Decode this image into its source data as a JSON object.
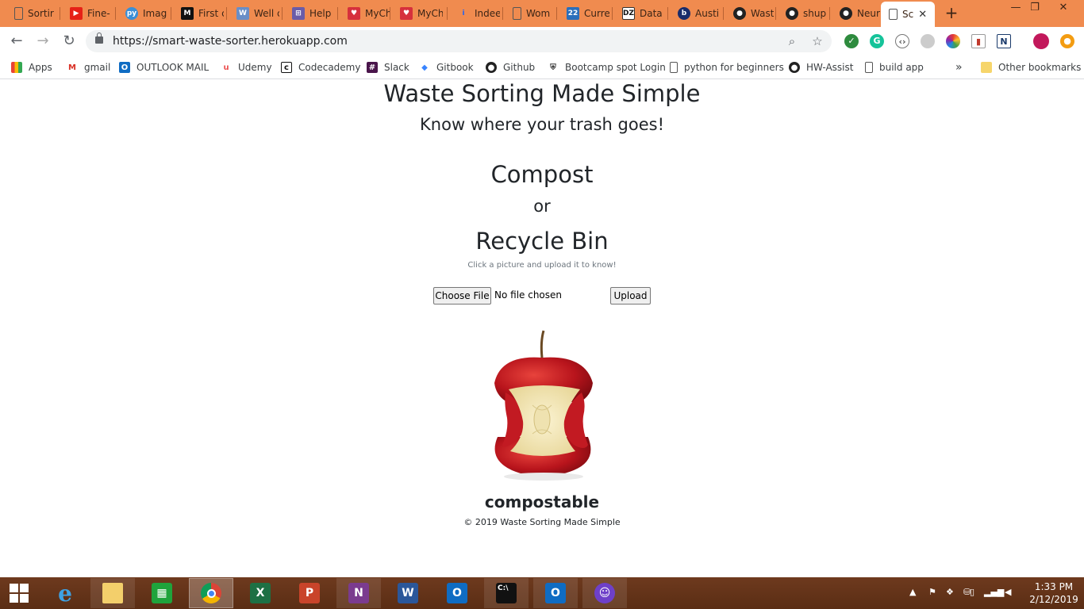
{
  "browser": {
    "tabs": [
      {
        "label": "Sortir",
        "icon": "document-icon"
      },
      {
        "label": "Fine-",
        "icon": "youtube-icon"
      },
      {
        "label": "Imag",
        "icon": "pypi-icon"
      },
      {
        "label": "First c",
        "icon": "medium-icon"
      },
      {
        "label": "Well c",
        "icon": "webmd-icon"
      },
      {
        "label": "Help",
        "icon": "grid-icon"
      },
      {
        "label": "MyCh",
        "icon": "mychart-icon"
      },
      {
        "label": "MyCh",
        "icon": "mychart-icon"
      },
      {
        "label": "Indee",
        "icon": "indeed-icon"
      },
      {
        "label": "Wom",
        "icon": "document-icon"
      },
      {
        "label": "Curre",
        "icon": "calendar-22-icon"
      },
      {
        "label": "Data",
        "icon": "dzone-icon"
      },
      {
        "label": "Austi",
        "icon": "b-icon"
      },
      {
        "label": "Wast",
        "icon": "github-icon"
      },
      {
        "label": "shup",
        "icon": "github-icon"
      },
      {
        "label": "Neur",
        "icon": "github-icon"
      }
    ],
    "active_tab": {
      "label": "Sc",
      "icon": "document-icon"
    },
    "url": "https://smart-waste-sorter.herokuapp.com",
    "bookmarks": [
      {
        "label": "Apps",
        "icon": "apps-grid-icon"
      },
      {
        "label": "gmail",
        "icon": "gmail-icon"
      },
      {
        "label": "OUTLOOK MAIL",
        "icon": "outlook-icon"
      },
      {
        "label": "Udemy",
        "icon": "udemy-icon"
      },
      {
        "label": "Codecademy",
        "icon": "codecademy-icon"
      },
      {
        "label": "Slack",
        "icon": "slack-icon"
      },
      {
        "label": "Gitbook",
        "icon": "gitbook-icon"
      },
      {
        "label": "Github",
        "icon": "github-icon"
      },
      {
        "label": "Bootcamp spot Login",
        "icon": "shield-icon"
      },
      {
        "label": "python for beginners",
        "icon": "document-icon"
      },
      {
        "label": "HW-Assist",
        "icon": "github-icon"
      },
      {
        "label": "build app",
        "icon": "document-icon"
      }
    ],
    "bookmarks_overflow": "»",
    "other_bookmarks": "Other bookmarks"
  },
  "page": {
    "title": "Waste Sorting Made Simple",
    "subtitle": "Know where your trash goes!",
    "option_a": "Compost",
    "connector": "or",
    "option_b": "Recycle Bin",
    "hint": "Click a picture and upload it to know!",
    "choose_file_label": "Choose File",
    "no_file_text": "No file chosen",
    "upload_label": "Upload",
    "result": "compostable",
    "footer": "© 2019 Waste Sorting Made Simple"
  },
  "taskbar": {
    "clock_time": "1:33 PM",
    "clock_date": "2/12/2019"
  },
  "colors": {
    "tab_strip": "#f08b4f",
    "taskbar": "#5a2d14",
    "heading": "#212529"
  }
}
